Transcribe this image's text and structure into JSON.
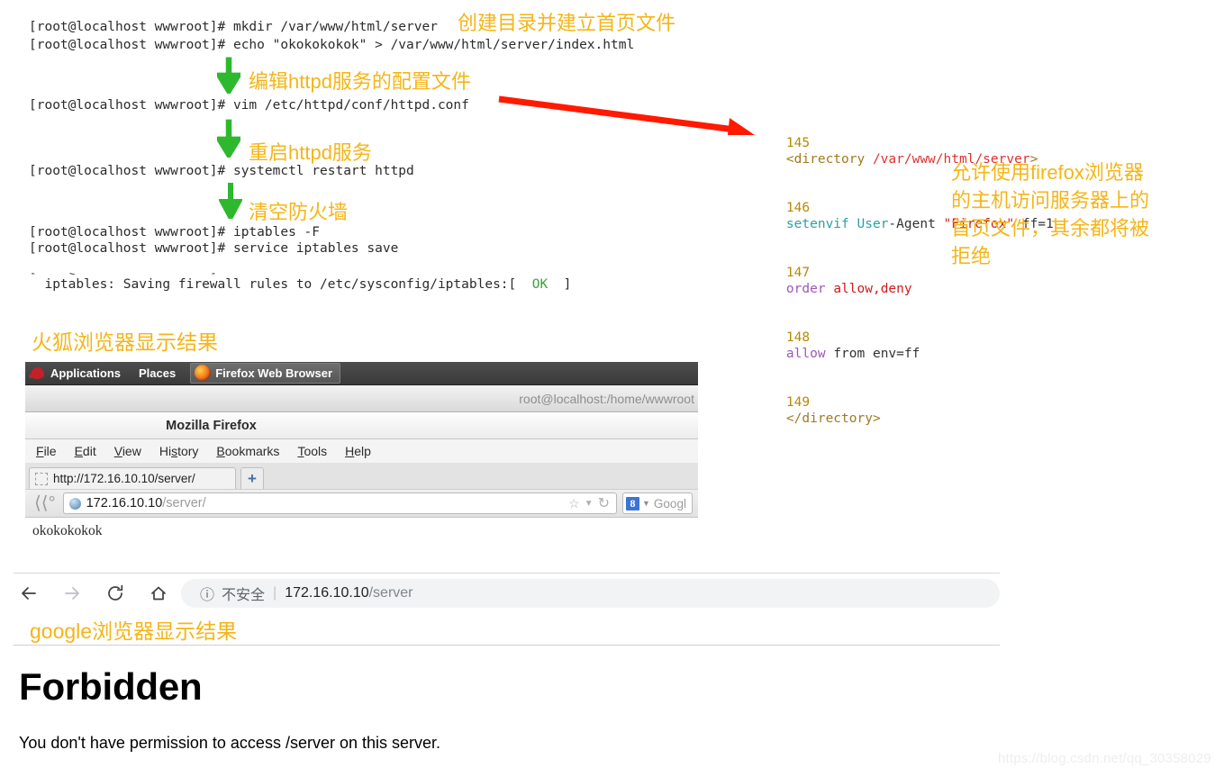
{
  "terminal": {
    "lines": [
      "[root@localhost wwwroot]# mkdir /var/www/html/server",
      "[root@localhost wwwroot]# echo \"okokokokok\" > /var/www/html/server/index.html",
      "[root@localhost wwwroot]# vim /etc/httpd/conf/httpd.conf",
      "[root@localhost wwwroot]# systemctl restart httpd",
      "[root@localhost wwwroot]# iptables -F",
      "[root@localhost wwwroot]# service iptables save"
    ],
    "save_result_prefix": "iptables: Saving firewall rules to /etc/sysconfig/iptables:[",
    "save_result_ok": "OK",
    "save_result_suffix": "]"
  },
  "annotations": {
    "create_dir": "创建目录并建立首页文件",
    "edit_conf": "编辑httpd服务的配置文件",
    "restart_httpd": "重启httpd服务",
    "clear_firewall": "清空防火墙",
    "config_explain": "允许使用firefox浏览器\n的主机访问服务器上的\n首页文件，其余都将被\n拒绝",
    "firefox_result": "火狐浏览器显示结果",
    "google_result": "google浏览器显示结果",
    "accent_color": "#f5b517",
    "arrow_green": "#2db82d",
    "arrow_red": "#ff1a00"
  },
  "config": {
    "lines": [
      {
        "num": "145",
        "parts": [
          {
            "t": "<directory ",
            "c": "tag"
          },
          {
            "t": "/var/www/html/server",
            "c": "path"
          },
          {
            "t": ">",
            "c": "tag"
          }
        ]
      },
      {
        "num": "146",
        "parts": [
          {
            "t": "setenvif ",
            "c": "dir"
          },
          {
            "t": "User",
            "c": "word"
          },
          {
            "t": "-Agent ",
            "c": "plain"
          },
          {
            "t": "\"Firefox\"",
            "c": "str"
          },
          {
            "t": " ff=1",
            "c": "plain"
          }
        ]
      },
      {
        "num": "147",
        "parts": [
          {
            "t": "order ",
            "c": "kw"
          },
          {
            "t": "allow,deny",
            "c": "red"
          }
        ]
      },
      {
        "num": "148",
        "parts": [
          {
            "t": "allow ",
            "c": "kw"
          },
          {
            "t": "from env=ff",
            "c": "plain"
          }
        ]
      },
      {
        "num": "149",
        "parts": [
          {
            "t": "</directory>",
            "c": "tag"
          }
        ]
      }
    ]
  },
  "firefox": {
    "panel": {
      "applications": "Applications",
      "places": "Places",
      "window_task": "Firefox Web Browser"
    },
    "terminal_window_title": "root@localhost:/home/wwwroot",
    "window_title": "Mozilla Firefox",
    "menu": [
      {
        "pre": "",
        "acc": "F",
        "post": "ile"
      },
      {
        "pre": "",
        "acc": "E",
        "post": "dit"
      },
      {
        "pre": "",
        "acc": "V",
        "post": "iew"
      },
      {
        "pre": "Hi",
        "acc": "s",
        "post": "tory"
      },
      {
        "pre": "",
        "acc": "B",
        "post": "ookmarks"
      },
      {
        "pre": "",
        "acc": "T",
        "post": "ools"
      },
      {
        "pre": "",
        "acc": "H",
        "post": "elp"
      }
    ],
    "tab_title": "http://172.16.10.10/server/",
    "new_tab_label": "+",
    "url_host": "172.16.10.10",
    "url_path": "/server/",
    "search_placeholder": "Googl",
    "search_engine_icon": "8",
    "page_body": "okokokokok"
  },
  "chrome": {
    "back_icon": "←",
    "forward_icon": "→",
    "reload_icon": "⟳",
    "home_icon": "⌂",
    "security_icon": "ⓘ",
    "security_label": "不安全",
    "divider": "|",
    "url_host": "172.16.10.10",
    "url_path": "/server",
    "page_heading": "Forbidden",
    "page_text": "You don't have permission to access /server on this server."
  },
  "watermark": "https://blog.csdn.net/qq_30358029"
}
